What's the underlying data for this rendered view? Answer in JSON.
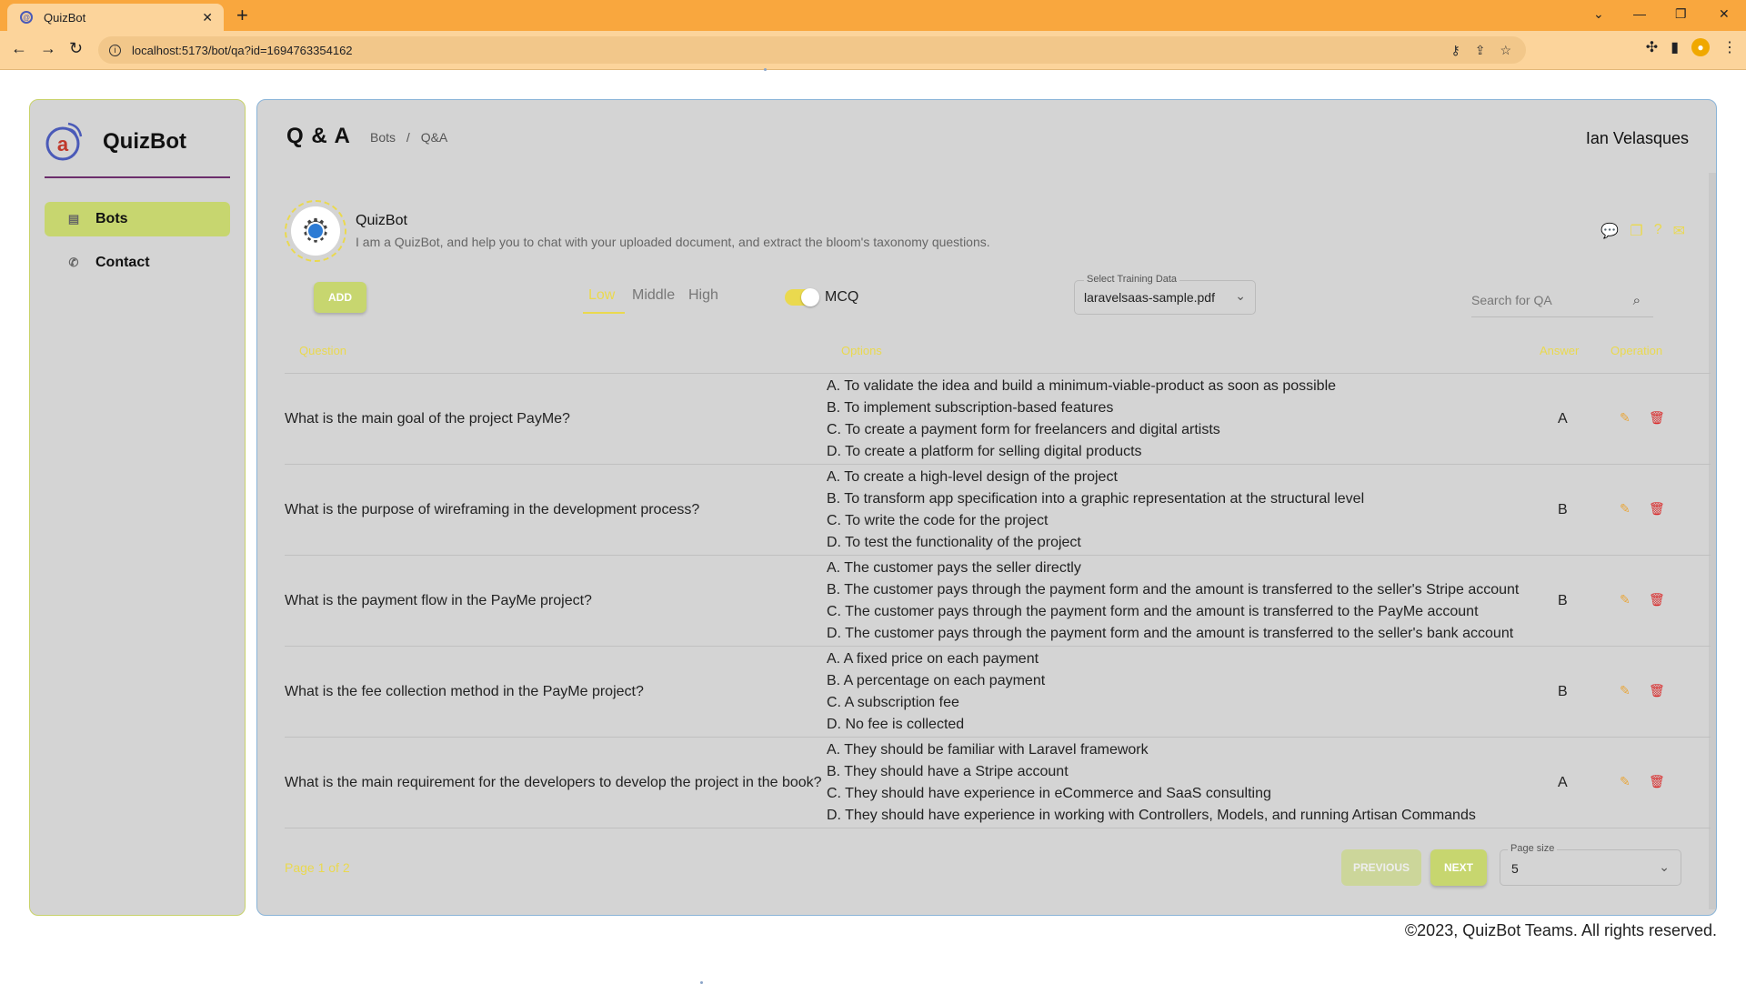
{
  "browser": {
    "tab_title": "QuizBot",
    "tab_close": "✕",
    "new_tab": "+",
    "url": "localhost:5173/bot/qa?id=1694763354162",
    "window_controls": [
      "⌄",
      "—",
      "❐",
      "✕"
    ]
  },
  "sidebar": {
    "brand": "QuizBot",
    "items": [
      {
        "label": "Bots",
        "icon": "document-icon",
        "active": true
      },
      {
        "label": "Contact",
        "icon": "phone-icon",
        "active": false
      }
    ]
  },
  "header": {
    "title": "Q & A",
    "breadcrumbs": [
      "Bots",
      "/",
      "Q&A"
    ],
    "user": "Ian Velasques"
  },
  "bot": {
    "name": "QuizBot",
    "description": "I am a QuizBot, and help you to chat with your uploaded document, and extract the bloom's taxonomy questions."
  },
  "controls": {
    "add_label": "ADD",
    "levels": [
      "Low",
      "Middle",
      "High"
    ],
    "active_level": "Low",
    "mcq_label": "MCQ",
    "mcq_enabled": true,
    "training_select_label": "Select Training Data",
    "training_select_value": "laravelsaas-sample.pdf",
    "search_placeholder": "Search for QA"
  },
  "table": {
    "headers": [
      "Question",
      "Options",
      "Answer",
      "Operation"
    ],
    "rows": [
      {
        "question": "What is the main goal of the project PayMe?",
        "options": [
          "A. To validate the idea and build a minimum-viable-product as soon as possible",
          "B. To implement subscription-based features",
          "C. To create a payment form for freelancers and digital artists",
          "D. To create a platform for selling digital products"
        ],
        "answer": "A"
      },
      {
        "question": "What is the purpose of wireframing in the development process?",
        "options": [
          "A. To create a high-level design of the project",
          "B. To transform app specification into a graphic representation at the structural level",
          "C. To write the code for the project",
          "D. To test the functionality of the project"
        ],
        "answer": "B"
      },
      {
        "question": "What is the payment flow in the PayMe project?",
        "options": [
          "A. The customer pays the seller directly",
          "B. The customer pays through the payment form and the amount is transferred to the seller's Stripe account",
          "C. The customer pays through the payment form and the amount is transferred to the PayMe account",
          "D. The customer pays through the payment form and the amount is transferred to the seller's bank account"
        ],
        "answer": "B"
      },
      {
        "question": "What is the fee collection method in the PayMe project?",
        "options": [
          "A. A fixed price on each payment",
          "B. A percentage on each payment",
          "C. A subscription fee",
          "D. No fee is collected"
        ],
        "answer": "B"
      },
      {
        "question": "What is the main requirement for the developers to develop the project in the book?",
        "options": [
          "A. They should be familiar with Laravel framework",
          "B. They should have a Stripe account",
          "C. They should have experience in eCommerce and SaaS consulting",
          "D. They should have experience in working with Controllers, Models, and running Artisan Commands"
        ],
        "answer": "A"
      }
    ]
  },
  "pagination": {
    "info": "Page 1 of 2",
    "previous": "PREVIOUS",
    "next": "NEXT",
    "page_size_label": "Page size",
    "page_size_value": "5"
  },
  "footer": "©2023, QuizBot Teams. All rights reserved.",
  "colors": {
    "browser_bar": "#f9a73e",
    "accent_green": "#c7d66f",
    "accent_yellow": "#ead94e",
    "panel": "#d4d4d4",
    "delete_red": "#d92a2a"
  }
}
